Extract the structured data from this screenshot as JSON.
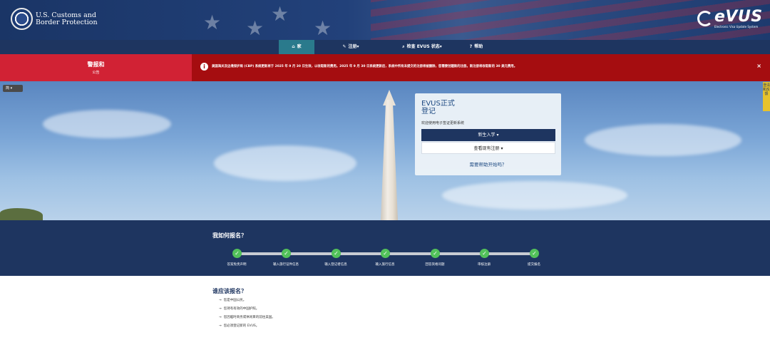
{
  "header": {
    "agency_line1": "U.S. Customs and",
    "agency_line2": "Border Protection",
    "brand_logo_text": "eVUS",
    "brand_logo_sub": "Electronic Visa Update System"
  },
  "nav": {
    "items": [
      {
        "label": "家",
        "icon": "home-icon"
      },
      {
        "label": "注册▾",
        "icon": "pencil-icon"
      },
      {
        "label": "检查 EVUS 状态▾",
        "icon": "search-icon"
      },
      {
        "label": "帮助",
        "icon": "question-icon"
      }
    ]
  },
  "alert": {
    "title": "警报和",
    "subtitle": "公告",
    "message": "美国海关及边境保护局 (CBP) 系统更新将于 2025 年 9 月 30 日生效，以收取新的费用。2025 年 9 月 30 日系统更新后，系统中所有未提交的注册将被删除，您需要创建新的注册。新注册将收取新的 30 美元费用。",
    "close_label": "×"
  },
  "lang": {
    "label": "简 ▾"
  },
  "side_tab": {
    "label": "澄清和反馈"
  },
  "card": {
    "title_line1": "EVUS正式",
    "title_line2": "登记",
    "welcome": "欢迎使用电子签证更新系统",
    "new_button": "新生入学 ▾",
    "view_button": "查看现有注册 ▾",
    "help_link": "需要帮助开始吗？"
  },
  "steps": {
    "title": "我如何报名？",
    "items": [
      {
        "label": "答案免责声明"
      },
      {
        "label": "输入旅行证件信息"
      },
      {
        "label": "输入登记者信息"
      },
      {
        "label": "输入旅行信息"
      },
      {
        "label": "回答资格问题"
      },
      {
        "label": "审核注册"
      },
      {
        "label": "提交报名"
      }
    ]
  },
  "who": {
    "title": "谁应该报名？",
    "items": [
      "您是中国公民。",
      "您持有有效的中国护照。",
      "您因临时商务或休闲目的前往美国。",
      "您必须登记新的 EVUS。"
    ]
  },
  "colors": {
    "navy": "#1e3560",
    "alert_red": "#d12234",
    "alert_dark_red": "#a50d10",
    "step_green": "#52c15a",
    "nav_active": "#2a7a8c"
  }
}
